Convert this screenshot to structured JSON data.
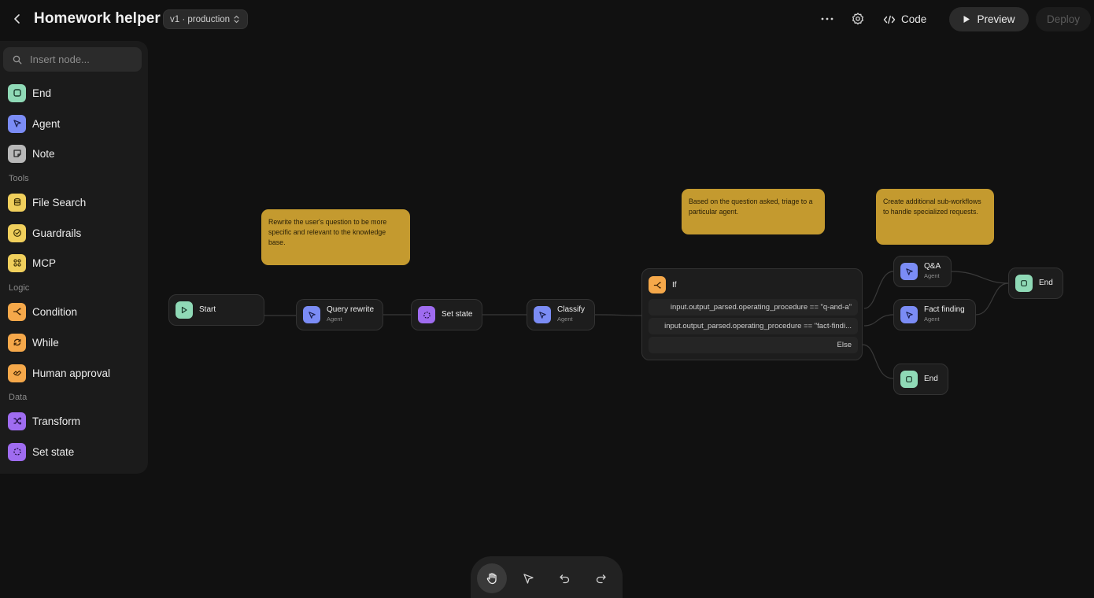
{
  "header": {
    "title": "Homework helper",
    "version": "v1 · production",
    "code_label": "Code",
    "preview_label": "Preview",
    "deploy_label": "Deploy"
  },
  "sidebar": {
    "search_placeholder": "Insert node...",
    "top_items": [
      {
        "label": "End",
        "icon": "end-icon",
        "color": "#8fd9b6"
      },
      {
        "label": "Agent",
        "icon": "agent-icon",
        "color": "#7b8cf5"
      },
      {
        "label": "Note",
        "icon": "note-icon",
        "color": "#b8b8b8"
      }
    ],
    "sections": [
      {
        "label": "Tools",
        "items": [
          {
            "label": "File Search",
            "icon": "database-icon",
            "color": "#f0cf5c"
          },
          {
            "label": "Guardrails",
            "icon": "shield-icon",
            "color": "#f0cf5c"
          },
          {
            "label": "MCP",
            "icon": "mcp-icon",
            "color": "#f0cf5c"
          }
        ]
      },
      {
        "label": "Logic",
        "items": [
          {
            "label": "Condition",
            "icon": "branch-icon",
            "color": "#f5a84a"
          },
          {
            "label": "While",
            "icon": "loop-icon",
            "color": "#f5a84a"
          },
          {
            "label": "Human approval",
            "icon": "approval-icon",
            "color": "#f5a84a"
          }
        ]
      },
      {
        "label": "Data",
        "items": [
          {
            "label": "Transform",
            "icon": "shuffle-icon",
            "color": "#9f6cf0"
          },
          {
            "label": "Set state",
            "icon": "state-icon",
            "color": "#9f6cf0"
          }
        ]
      }
    ]
  },
  "canvas": {
    "nodes": {
      "start": {
        "title": "Start"
      },
      "query_rewrite": {
        "title": "Query rewrite",
        "subtitle": "Agent"
      },
      "set_state": {
        "title": "Set state"
      },
      "classify": {
        "title": "Classify",
        "subtitle": "Agent"
      },
      "qa": {
        "title": "Q&A",
        "subtitle": "Agent"
      },
      "fact_finding": {
        "title": "Fact finding",
        "subtitle": "Agent"
      },
      "end_top": {
        "title": "End"
      },
      "end_bottom": {
        "title": "End"
      }
    },
    "if_node": {
      "title": "If",
      "conditions": [
        "input.output_parsed.operating_procedure == \"q-and-a\"",
        "input.output_parsed.operating_procedure == \"fact-findi..."
      ],
      "else_label": "Else"
    },
    "notes": [
      "Rewrite the user's question to be more specific and relevant to the knowledge base.",
      "Based on the question asked, triage to a particular agent.",
      "Create additional sub-workflows to handle specialized requests."
    ]
  },
  "toolbar": {
    "tools": [
      "hand-icon",
      "pointer-icon",
      "undo-icon",
      "redo-icon"
    ],
    "active": "hand-icon"
  }
}
